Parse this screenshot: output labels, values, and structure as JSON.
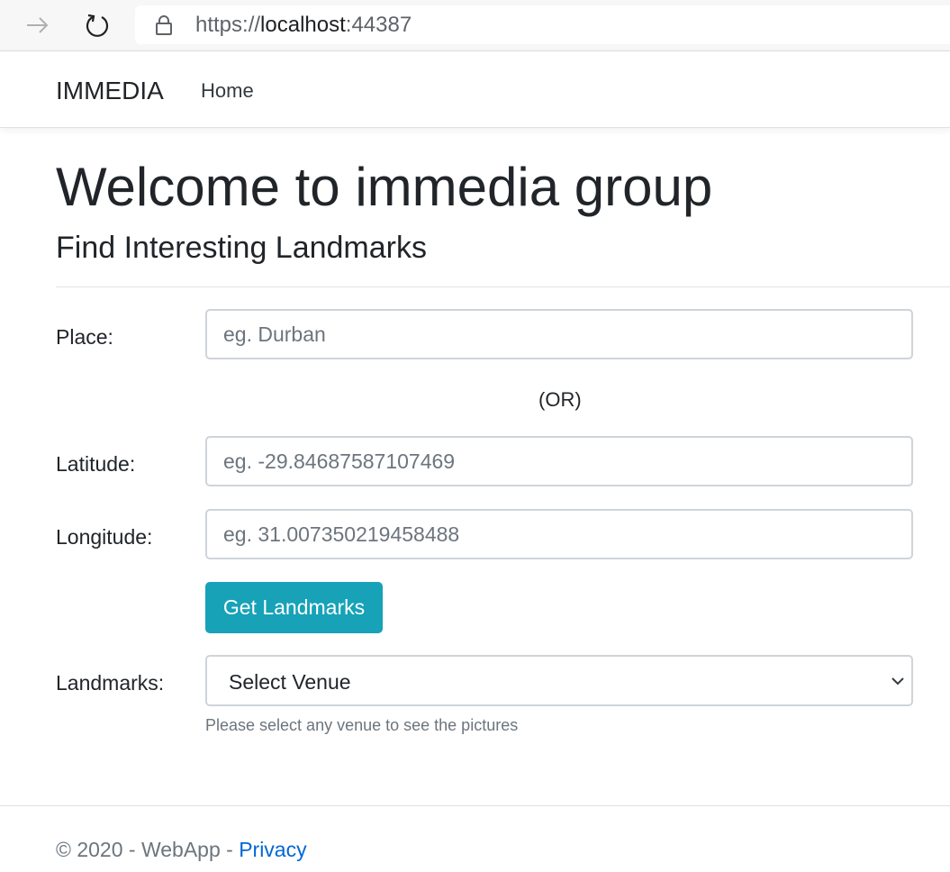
{
  "browser": {
    "url_scheme": "https://",
    "url_host": "localhost",
    "url_port": ":44387"
  },
  "navbar": {
    "brand": "IMMEDIA",
    "home": "Home"
  },
  "main": {
    "title": "Welcome to immedia group",
    "subtitle": "Find Interesting Landmarks",
    "place_label": "Place:",
    "place_placeholder": "eg. Durban",
    "place_value": "",
    "or_text": "(OR)",
    "latitude_label": "Latitude:",
    "latitude_placeholder": "eg. -29.84687587107469",
    "latitude_value": "",
    "longitude_label": "Longitude:",
    "longitude_placeholder": "eg. 31.007350219458488",
    "longitude_value": "",
    "get_button": "Get Landmarks",
    "landmarks_label": "Landmarks:",
    "landmarks_selected": "Select Venue",
    "help_text": "Please select any venue to see the pictures"
  },
  "footer": {
    "copyright": "© 2020 - WebApp - ",
    "privacy": "Privacy"
  },
  "colors": {
    "accent": "#17a2b8",
    "link": "#0366d6",
    "muted": "#6c757d"
  },
  "icons": {
    "forward": "arrow-right-icon",
    "reload": "reload-icon",
    "lock": "lock-icon",
    "select": "chevron-down-icon"
  }
}
